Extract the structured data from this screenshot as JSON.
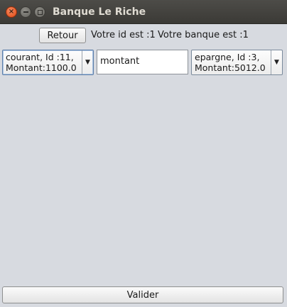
{
  "window": {
    "title": "Banque Le Riche",
    "close_glyph": "×"
  },
  "header": {
    "back_label": "Retour",
    "id_text": "Votre id est :1",
    "bank_text": "Votre banque est :1"
  },
  "transfer": {
    "from_account_line1": "courant, Id :11,",
    "from_account_line2": "Montant:1100.0",
    "amount_value": "montant",
    "to_account_line1": "epargne, Id :3,",
    "to_account_line2": "Montant:5012.0"
  },
  "footer": {
    "submit_label": "Valider"
  },
  "icons": {
    "close": "close-icon",
    "minimize": "minimize-icon",
    "maximize": "maximize-icon",
    "dropdown": "triangle-down-icon"
  },
  "colors": {
    "titlebar": "#3b3a36",
    "close_button": "#dd4814",
    "window_background": "#d7dae0"
  }
}
